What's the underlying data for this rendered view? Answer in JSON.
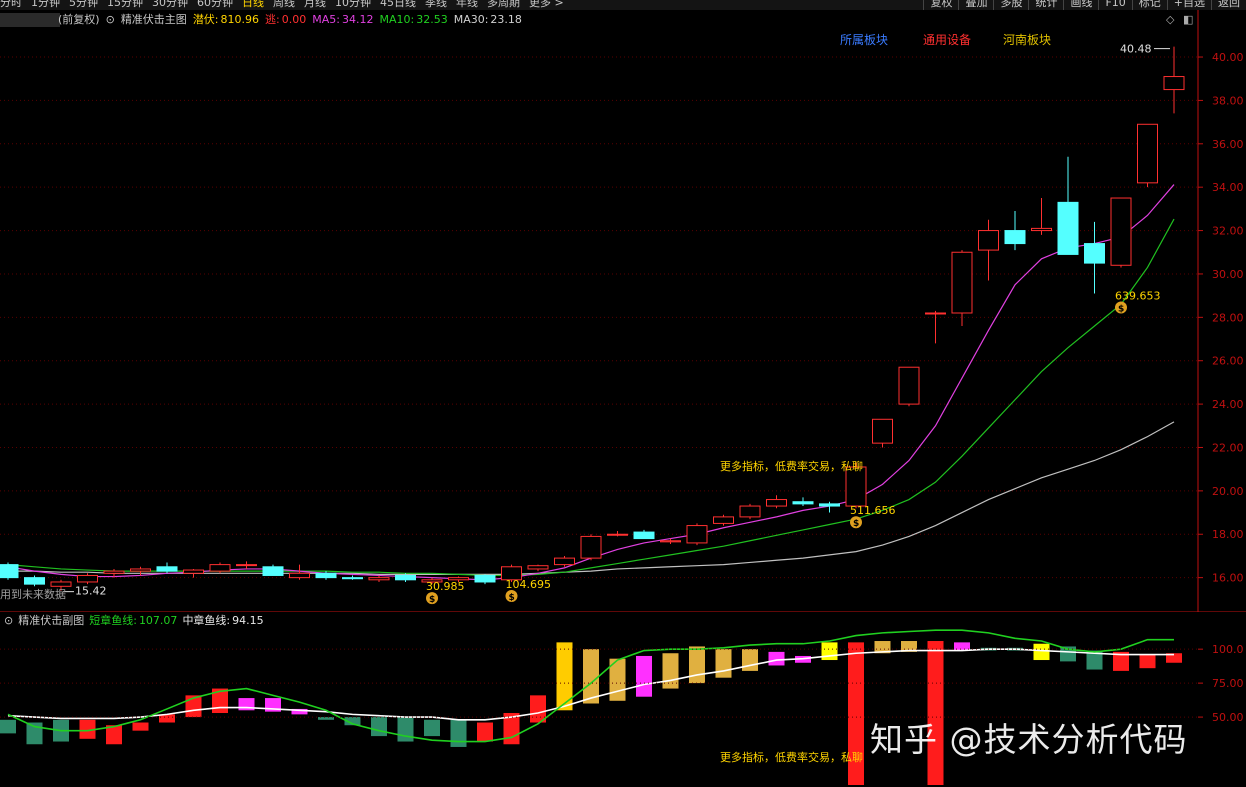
{
  "topbar": {
    "periods": [
      "分时",
      "1分钟",
      "5分钟",
      "15分钟",
      "30分钟",
      "60分钟",
      "日线",
      "周线",
      "月线",
      "10分钟",
      "45日线",
      "季线",
      "年线",
      "多周期",
      "更多 >"
    ],
    "active_period": "日线",
    "right_buttons": [
      "复权",
      "叠加",
      "多股",
      "统计",
      "画线",
      "F10",
      "标记",
      "+自选",
      "返回"
    ]
  },
  "main_indicator": {
    "prefix": "(前复权)",
    "name": "精准伏击主图",
    "qf_label": "潜伏:",
    "qf_value": "810.96",
    "tao_label": "逃:",
    "tao_value": "0.00",
    "ma5_label": "MA5:",
    "ma5_value": "34.12",
    "ma10_label": "MA10:",
    "ma10_value": "32.53",
    "ma30_label": "MA30:",
    "ma30_value": "23.18"
  },
  "sector_tags": [
    {
      "label": "所属板块",
      "color": "#3a7bff"
    },
    {
      "label": "通用设备",
      "color": "#ff3030"
    },
    {
      "label": "河南板块",
      "color": "#e0c000"
    }
  ],
  "future_note": "用到未来数据",
  "ad_text": "更多指标，低费率交易，私聊",
  "price_axis": {
    "ticks": [
      "40.00",
      "38.00",
      "36.00",
      "34.00",
      "32.00",
      "30.00",
      "28.00",
      "26.00",
      "24.00",
      "22.00",
      "20.00",
      "18.00",
      "16.00"
    ],
    "high_label": "40.48",
    "low_label": "15.42"
  },
  "money_markers": [
    {
      "value": "30.985"
    },
    {
      "value": "104.695"
    },
    {
      "value": "511.656"
    },
    {
      "value": "639.653"
    }
  ],
  "sub_indicator": {
    "name": "精准伏击副图",
    "short_label": "短章鱼线:",
    "short_value": "107.07",
    "mid_label": "中章鱼线:",
    "mid_value": "94.15"
  },
  "sub_axis_ticks": [
    "100.0",
    "75.00",
    "50.00"
  ],
  "watermark": "知乎 @技术分析代码",
  "colors": {
    "up": "#ff3030",
    "down": "#54ffff",
    "ma5": "#e040e0",
    "ma10": "#20c020",
    "ma30": "#c0c0c0",
    "grid": "#5a0000",
    "axis": "#c01010"
  },
  "chart_data": {
    "type": "candlestick",
    "ylim": [
      14.6,
      41.2
    ],
    "candles": [
      {
        "o": 16.6,
        "h": 16.7,
        "l": 15.9,
        "c": 16.0
      },
      {
        "o": 16.0,
        "h": 16.1,
        "l": 15.6,
        "c": 15.7
      },
      {
        "o": 15.6,
        "h": 15.9,
        "l": 15.4,
        "c": 15.8
      },
      {
        "o": 15.8,
        "h": 16.2,
        "l": 15.7,
        "c": 16.1
      },
      {
        "o": 16.2,
        "h": 16.4,
        "l": 16.0,
        "c": 16.3
      },
      {
        "o": 16.3,
        "h": 16.5,
        "l": 16.1,
        "c": 16.4
      },
      {
        "o": 16.5,
        "h": 16.7,
        "l": 16.2,
        "c": 16.3
      },
      {
        "o": 16.2,
        "h": 16.4,
        "l": 16.0,
        "c": 16.35
      },
      {
        "o": 16.3,
        "h": 16.7,
        "l": 16.2,
        "c": 16.6
      },
      {
        "o": 16.6,
        "h": 16.75,
        "l": 16.4,
        "c": 16.6
      },
      {
        "o": 16.5,
        "h": 16.6,
        "l": 16.1,
        "c": 16.1
      },
      {
        "o": 16.0,
        "h": 16.6,
        "l": 15.9,
        "c": 16.2
      },
      {
        "o": 16.2,
        "h": 16.3,
        "l": 15.9,
        "c": 16.0
      },
      {
        "o": 16.0,
        "h": 16.1,
        "l": 15.9,
        "c": 15.95
      },
      {
        "o": 15.9,
        "h": 16.1,
        "l": 15.8,
        "c": 16.0
      },
      {
        "o": 16.1,
        "h": 16.2,
        "l": 15.8,
        "c": 15.9
      },
      {
        "o": 15.8,
        "h": 16.0,
        "l": 15.7,
        "c": 15.9
      },
      {
        "o": 15.9,
        "h": 16.05,
        "l": 15.8,
        "c": 16.0
      },
      {
        "o": 16.1,
        "h": 16.15,
        "l": 15.7,
        "c": 15.8
      },
      {
        "o": 15.9,
        "h": 16.6,
        "l": 15.8,
        "c": 16.5
      },
      {
        "o": 16.4,
        "h": 16.6,
        "l": 16.3,
        "c": 16.55
      },
      {
        "o": 16.6,
        "h": 17.0,
        "l": 16.5,
        "c": 16.9
      },
      {
        "o": 16.9,
        "h": 18.0,
        "l": 16.8,
        "c": 17.9
      },
      {
        "o": 18.0,
        "h": 18.15,
        "l": 17.9,
        "c": 18.0
      },
      {
        "o": 18.1,
        "h": 18.2,
        "l": 17.8,
        "c": 17.8
      },
      {
        "o": 17.65,
        "h": 17.8,
        "l": 17.55,
        "c": 17.7
      },
      {
        "o": 17.6,
        "h": 18.5,
        "l": 17.5,
        "c": 18.4
      },
      {
        "o": 18.5,
        "h": 18.9,
        "l": 18.4,
        "c": 18.8
      },
      {
        "o": 18.8,
        "h": 19.4,
        "l": 18.7,
        "c": 19.3
      },
      {
        "o": 19.3,
        "h": 19.8,
        "l": 19.2,
        "c": 19.6
      },
      {
        "o": 19.5,
        "h": 19.7,
        "l": 19.3,
        "c": 19.4
      },
      {
        "o": 19.4,
        "h": 19.5,
        "l": 19.0,
        "c": 19.3
      },
      {
        "o": 19.3,
        "h": 21.3,
        "l": 19.2,
        "c": 21.1
      },
      {
        "o": 22.2,
        "h": 23.3,
        "l": 22.0,
        "c": 23.3
      },
      {
        "o": 24.0,
        "h": 25.7,
        "l": 23.9,
        "c": 25.7
      },
      {
        "o": 28.2,
        "h": 28.3,
        "l": 26.8,
        "c": 28.2
      },
      {
        "o": 28.2,
        "h": 31.1,
        "l": 27.6,
        "c": 31.0
      },
      {
        "o": 31.1,
        "h": 32.5,
        "l": 29.7,
        "c": 32.0
      },
      {
        "o": 32.0,
        "h": 32.9,
        "l": 31.1,
        "c": 31.4
      },
      {
        "o": 32.0,
        "h": 33.5,
        "l": 31.8,
        "c": 32.1
      },
      {
        "o": 33.3,
        "h": 35.4,
        "l": 30.9,
        "c": 30.9
      },
      {
        "o": 31.4,
        "h": 32.4,
        "l": 29.1,
        "c": 30.5
      },
      {
        "o": 30.4,
        "h": 33.5,
        "l": 30.3,
        "c": 33.5
      },
      {
        "o": 34.2,
        "h": 36.9,
        "l": 34.0,
        "c": 36.9
      },
      {
        "o": 38.5,
        "h": 40.48,
        "l": 37.4,
        "c": 39.1
      }
    ],
    "ma5": [
      16.5,
      16.3,
      16.15,
      16.05,
      16.05,
      16.1,
      16.2,
      16.25,
      16.35,
      16.4,
      16.4,
      16.3,
      16.2,
      16.15,
      16.1,
      16.05,
      16.0,
      15.95,
      15.9,
      16.0,
      16.2,
      16.45,
      16.9,
      17.3,
      17.6,
      17.8,
      18.0,
      18.3,
      18.55,
      18.8,
      19.1,
      19.3,
      19.6,
      20.3,
      21.4,
      23.0,
      25.2,
      27.4,
      29.5,
      30.7,
      31.2,
      31.4,
      31.7,
      32.7,
      34.12
    ],
    "ma10": [
      16.6,
      16.5,
      16.4,
      16.35,
      16.3,
      16.3,
      16.3,
      16.3,
      16.3,
      16.3,
      16.3,
      16.3,
      16.3,
      16.25,
      16.25,
      16.2,
      16.2,
      16.15,
      16.1,
      16.1,
      16.15,
      16.25,
      16.45,
      16.65,
      16.85,
      17.05,
      17.25,
      17.45,
      17.7,
      17.95,
      18.2,
      18.45,
      18.7,
      19.1,
      19.6,
      20.4,
      21.6,
      22.9,
      24.2,
      25.5,
      26.6,
      27.6,
      28.6,
      30.3,
      32.53
    ],
    "ma30": [
      16.3,
      16.3,
      16.25,
      16.25,
      16.2,
      16.2,
      16.2,
      16.2,
      16.2,
      16.2,
      16.2,
      16.2,
      16.2,
      16.2,
      16.15,
      16.15,
      16.15,
      16.15,
      16.15,
      16.15,
      16.2,
      16.25,
      16.3,
      16.4,
      16.45,
      16.5,
      16.55,
      16.6,
      16.7,
      16.8,
      16.9,
      17.05,
      17.2,
      17.5,
      17.9,
      18.4,
      19.0,
      19.6,
      20.1,
      20.6,
      21.0,
      21.4,
      21.9,
      22.5,
      23.18
    ]
  },
  "sub_chart_data": {
    "type": "bar",
    "ylim": [
      0,
      120
    ],
    "bars": [
      {
        "top": 48,
        "bottom": 38,
        "color": "#2e8b6a"
      },
      {
        "top": 46,
        "bottom": 30,
        "color": "#2e8b6a"
      },
      {
        "top": 48,
        "bottom": 32,
        "color": "#2e8b6a"
      },
      {
        "top": 48,
        "bottom": 34,
        "color": "#ff1c1c"
      },
      {
        "top": 44,
        "bottom": 30,
        "color": "#ff1c1c"
      },
      {
        "top": 46,
        "bottom": 40,
        "color": "#ff1c1c"
      },
      {
        "top": 52,
        "bottom": 46,
        "color": "#ff1c1c"
      },
      {
        "top": 66,
        "bottom": 50,
        "color": "#ff1c1c"
      },
      {
        "top": 71,
        "bottom": 53,
        "color": "#ff1c1c"
      },
      {
        "top": 64,
        "bottom": 55,
        "color": "#ff30ff"
      },
      {
        "top": 64,
        "bottom": 54,
        "color": "#ff30ff"
      },
      {
        "top": 56,
        "bottom": 52,
        "color": "#ff30ff"
      },
      {
        "top": 50,
        "bottom": 48,
        "color": "#2e8b6a"
      },
      {
        "top": 50,
        "bottom": 44,
        "color": "#2e8b6a"
      },
      {
        "top": 50,
        "bottom": 36,
        "color": "#2e8b6a"
      },
      {
        "top": 50,
        "bottom": 32,
        "color": "#2e8b6a"
      },
      {
        "top": 48,
        "bottom": 36,
        "color": "#2e8b6a"
      },
      {
        "top": 48,
        "bottom": 28,
        "color": "#2e8b6a"
      },
      {
        "top": 46,
        "bottom": 32,
        "color": "#ff1c1c"
      },
      {
        "top": 53,
        "bottom": 30,
        "color": "#ff1c1c"
      },
      {
        "top": 66,
        "bottom": 46,
        "color": "#ff1c1c"
      },
      {
        "top": 105,
        "bottom": 55,
        "color": "#ffcc00"
      },
      {
        "top": 100,
        "bottom": 60,
        "color": "#e0b040"
      },
      {
        "top": 93,
        "bottom": 62,
        "color": "#e0b040"
      },
      {
        "top": 95,
        "bottom": 65,
        "color": "#ff30ff"
      },
      {
        "top": 97,
        "bottom": 71,
        "color": "#e0b040"
      },
      {
        "top": 102,
        "bottom": 75,
        "color": "#e0b040"
      },
      {
        "top": 100,
        "bottom": 79,
        "color": "#e0b040"
      },
      {
        "top": 100,
        "bottom": 84,
        "color": "#e0b040"
      },
      {
        "top": 98,
        "bottom": 88,
        "color": "#ff30ff"
      },
      {
        "top": 95,
        "bottom": 90,
        "color": "#ff30ff"
      },
      {
        "top": 105,
        "bottom": 92,
        "color": "#ffff00"
      },
      {
        "top": 105,
        "bottom": 0,
        "color": "#ff1c1c"
      },
      {
        "top": 106,
        "bottom": 97,
        "color": "#e0b040"
      },
      {
        "top": 106,
        "bottom": 98,
        "color": "#e0b040"
      },
      {
        "top": 106,
        "bottom": 0,
        "color": "#ff1c1c"
      },
      {
        "top": 105,
        "bottom": 99,
        "color": "#ff30ff"
      },
      {
        "top": 101,
        "bottom": 99,
        "color": "#2e8b6a"
      },
      {
        "top": 101,
        "bottom": 99,
        "color": "#2e8b6a"
      },
      {
        "top": 104,
        "bottom": 92,
        "color": "#ffff00"
      },
      {
        "top": 102,
        "bottom": 91,
        "color": "#2e8b6a"
      },
      {
        "top": 99,
        "bottom": 85,
        "color": "#2e8b6a"
      },
      {
        "top": 98,
        "bottom": 84,
        "color": "#ff1c1c"
      },
      {
        "top": 96,
        "bottom": 86,
        "color": "#ff1c1c"
      },
      {
        "top": 97,
        "bottom": 90,
        "color": "#ff1c1c"
      }
    ],
    "white_line": [
      51,
      50,
      49,
      49,
      49,
      50,
      52,
      55,
      57,
      57,
      56,
      55,
      54,
      52,
      51,
      50,
      50,
      48,
      48,
      50,
      53,
      58,
      64,
      69,
      74,
      77,
      81,
      84,
      88,
      92,
      93,
      95,
      97,
      98,
      99,
      99,
      99,
      100,
      100,
      99,
      98,
      97,
      96,
      96,
      96
    ],
    "green_line": [
      52,
      43,
      40,
      40,
      43,
      48,
      56,
      64,
      69,
      71,
      66,
      61,
      55,
      45,
      40,
      36,
      33,
      32,
      32,
      35,
      45,
      60,
      75,
      92,
      99,
      100,
      100,
      101,
      103,
      104,
      104,
      106,
      110,
      112,
      113,
      114,
      114,
      112,
      108,
      106,
      100,
      98,
      100,
      107,
      107
    ]
  }
}
